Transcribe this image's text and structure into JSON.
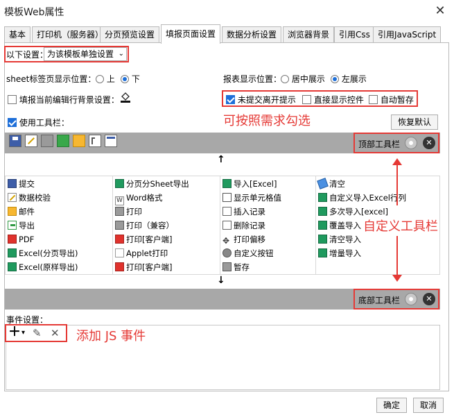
{
  "window": {
    "title": "模板Web属性",
    "close_icon": "close-icon"
  },
  "tabs": [
    {
      "label": "基本"
    },
    {
      "label": "打印机（服务器）"
    },
    {
      "label": "分页预览设置"
    },
    {
      "label": "填报页面设置",
      "active": true
    },
    {
      "label": "数据分析设置"
    },
    {
      "label": "浏览器背景"
    },
    {
      "label": "引用Css"
    },
    {
      "label": "引用JavaScript"
    }
  ],
  "settings": {
    "mode_label": "以下设置：",
    "mode_value": "为该模板单独设置",
    "sheet_pos_label": "sheet标签页显示位置：",
    "sheet_pos_options": [
      "上",
      "下"
    ],
    "sheet_pos_selected": "下",
    "report_pos_label": "报表显示位置：",
    "report_pos_options": [
      "居中展示",
      "左展示"
    ],
    "report_pos_selected": "左展示",
    "bg_label": "填报当前编辑行背景设置：",
    "bg_checked": false,
    "unsubmitted_label": "未提交离开提示",
    "unsubmitted_checked": true,
    "show_control_label": "直接显示控件",
    "show_control_checked": false,
    "autosave_label": "自动暂存",
    "autosave_checked": false,
    "use_toolbar_label": "使用工具栏：",
    "use_toolbar_checked": true,
    "restore_default": "恢复默认"
  },
  "annotations": {
    "check_note": "可按照需求勾选",
    "custom_toolbar_note": "自定义工具栏",
    "js_event_note": "添加 JS 事件"
  },
  "top_toolbar": {
    "label": "顶部工具栏",
    "icons": [
      "save-icon",
      "check-icon",
      "print-icon",
      "export-icon",
      "mail-icon",
      "tree-icon",
      "window-icon"
    ]
  },
  "bottom_toolbar": {
    "label": "底部工具栏"
  },
  "arrows": {
    "up": "↑",
    "down": "↓"
  },
  "grid": {
    "columns": [
      [
        {
          "icon": "save",
          "label": "提交"
        },
        {
          "icon": "check",
          "label": "数据校验"
        },
        {
          "icon": "mail",
          "label": "邮件"
        },
        {
          "icon": "export",
          "label": "导出"
        },
        {
          "icon": "pdf",
          "label": "PDF"
        },
        {
          "icon": "xls",
          "label": "Excel(分页导出)"
        },
        {
          "icon": "xls",
          "label": "Excel(原样导出)"
        }
      ],
      [
        {
          "icon": "xls",
          "label": "分页分Sheet导出"
        },
        {
          "icon": "word",
          "label": "Word格式"
        },
        {
          "icon": "print",
          "label": "打印"
        },
        {
          "icon": "print",
          "label": "打印（兼容）"
        },
        {
          "icon": "client",
          "label": "打印[客户端]"
        },
        {
          "icon": "applet",
          "label": "Applet打印"
        },
        {
          "icon": "pdf",
          "label": "打印[客户端]"
        }
      ],
      [
        {
          "icon": "xls",
          "label": "导入[Excel]"
        },
        {
          "icon": "cell",
          "label": "显示单元格值"
        },
        {
          "icon": "insert",
          "label": "插入记录"
        },
        {
          "icon": "del",
          "label": "删除记录"
        },
        {
          "icon": "move",
          "label": "打印偏移"
        },
        {
          "icon": "gear",
          "label": "自定义按钮"
        },
        {
          "icon": "print",
          "label": "暂存"
        }
      ],
      [
        {
          "icon": "clear",
          "label": "清空"
        },
        {
          "icon": "xls",
          "label": "自定义导入Excel行列"
        },
        {
          "icon": "xls",
          "label": "多次导入[excel]"
        },
        {
          "icon": "xls",
          "label": "覆盖导入"
        },
        {
          "icon": "xls",
          "label": "清空导入"
        },
        {
          "icon": "xls",
          "label": "增量导入"
        }
      ]
    ]
  },
  "events": {
    "label": "事件设置：",
    "add_icon": "＋",
    "dropdown_icon": "▾",
    "edit_icon": "✎",
    "delete_icon": "✕"
  },
  "footer": {
    "ok": "确定",
    "cancel": "取消"
  }
}
